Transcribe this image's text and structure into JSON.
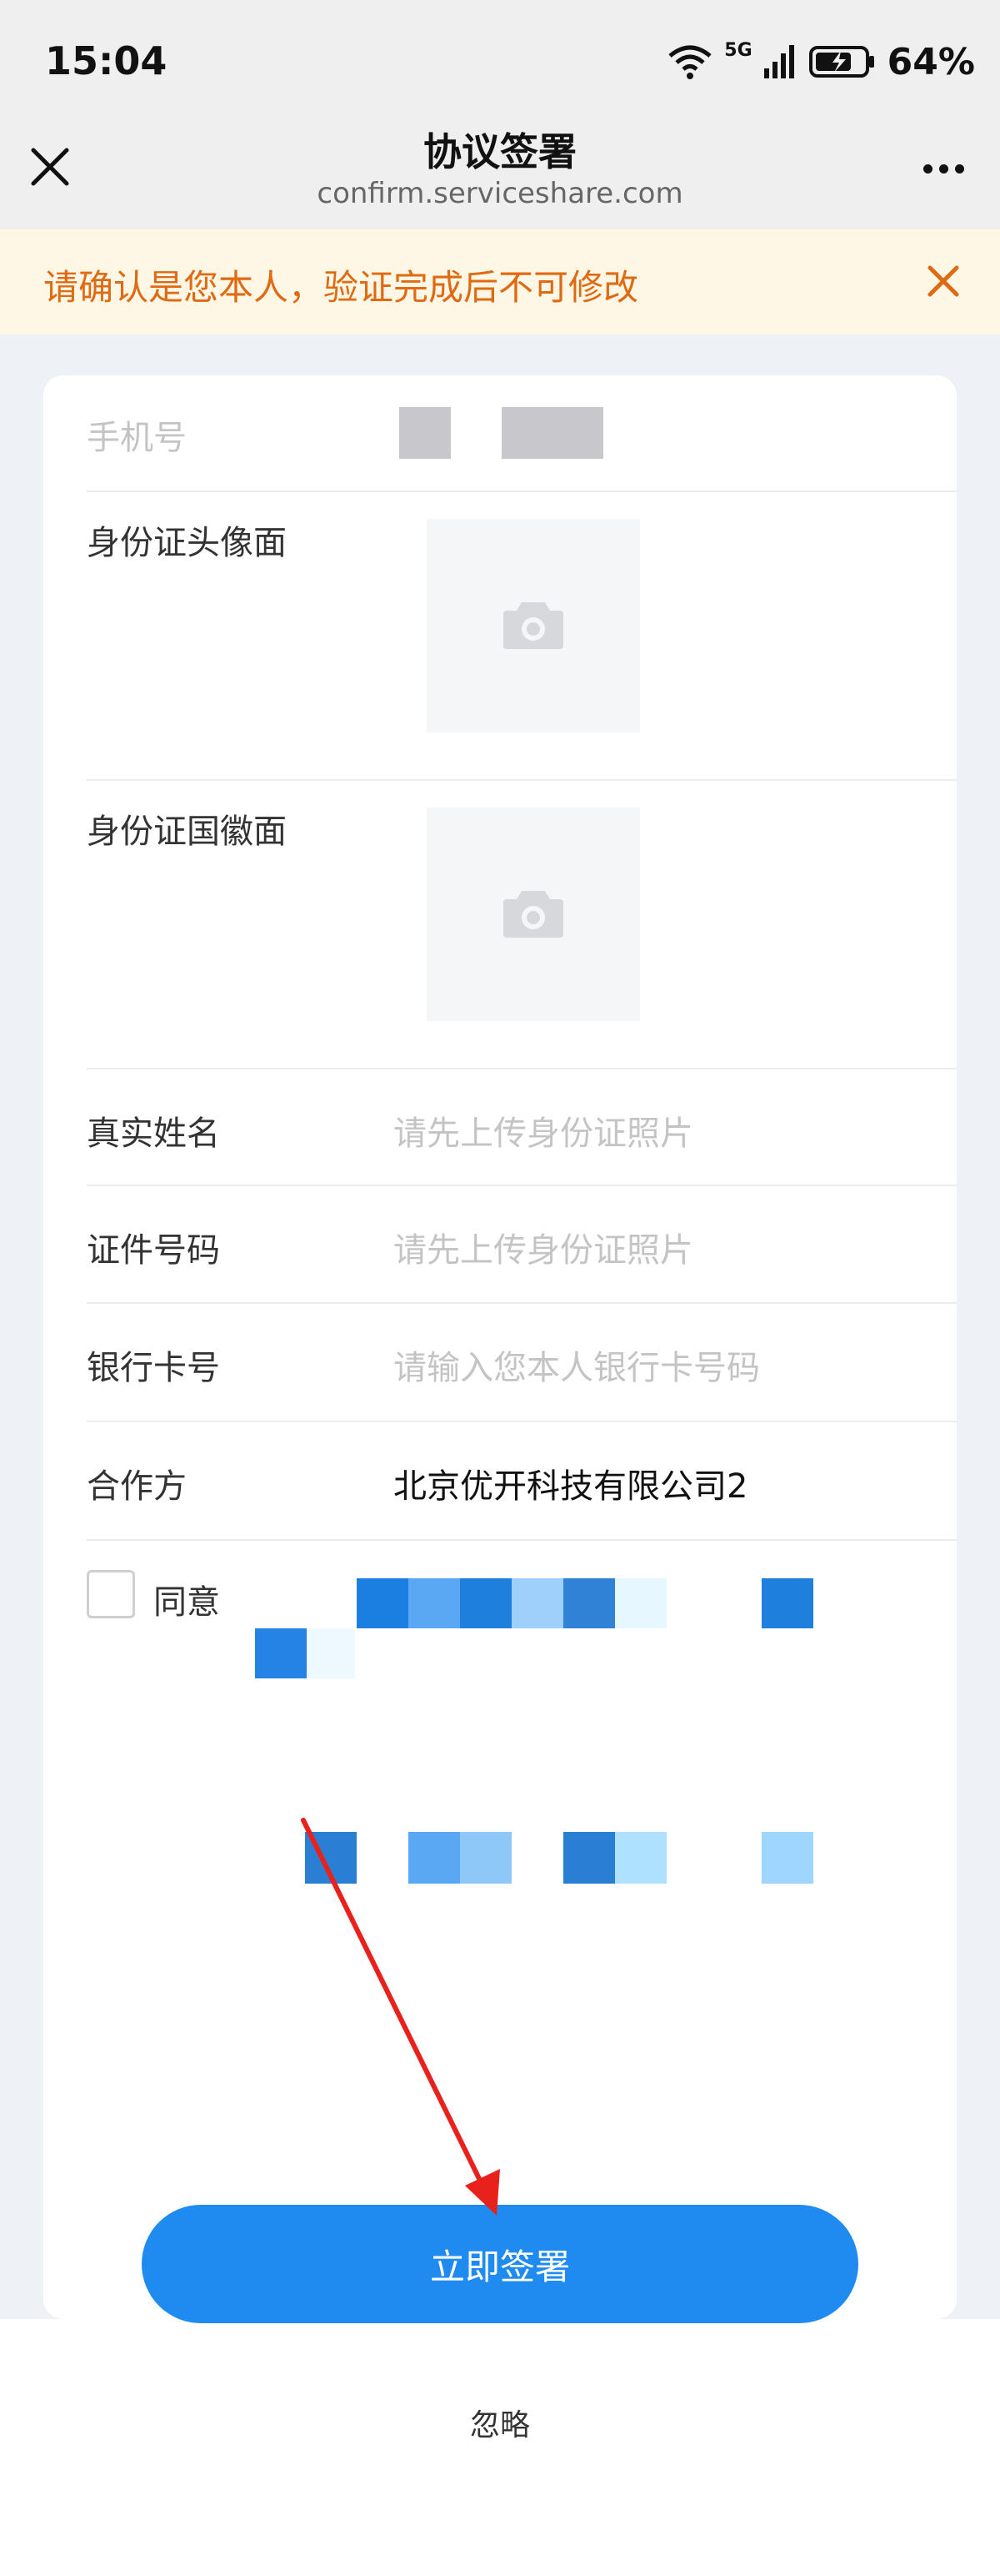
{
  "status_bar": {
    "time": "15:04",
    "battery": "64%",
    "network": "5G",
    "icons": [
      "wifi-icon",
      "signal-icon",
      "battery-charging-icon"
    ]
  },
  "header": {
    "title": "协议签署",
    "url": "confirm.serviceshare.com",
    "close_icon": "close-icon",
    "more_icon": "more-icon"
  },
  "notice": {
    "text": "请确认是您本人，验证完成后不可修改",
    "color": "#e06a12",
    "background": "#fff7e6"
  },
  "form": {
    "phone_label": "手机号",
    "id_front_label": "身份证头像面",
    "id_back_label": "身份证国徽面",
    "real_name_label": "真实姓名",
    "real_name_placeholder": "请先上传身份证照片",
    "id_number_label": "证件号码",
    "id_number_placeholder": "请先上传身份证照片",
    "bank_card_label": "银行卡号",
    "bank_card_placeholder": "请输入您本人银行卡号码",
    "partner_label": "合作方",
    "partner_value": "北京优开科技有限公司2",
    "agree_label": "同意"
  },
  "actions": {
    "sign_button": "立即签署",
    "ignore_link": "忽略"
  },
  "colors": {
    "accent": "#1f8bf0",
    "annotation_arrow": "#e8211c"
  }
}
